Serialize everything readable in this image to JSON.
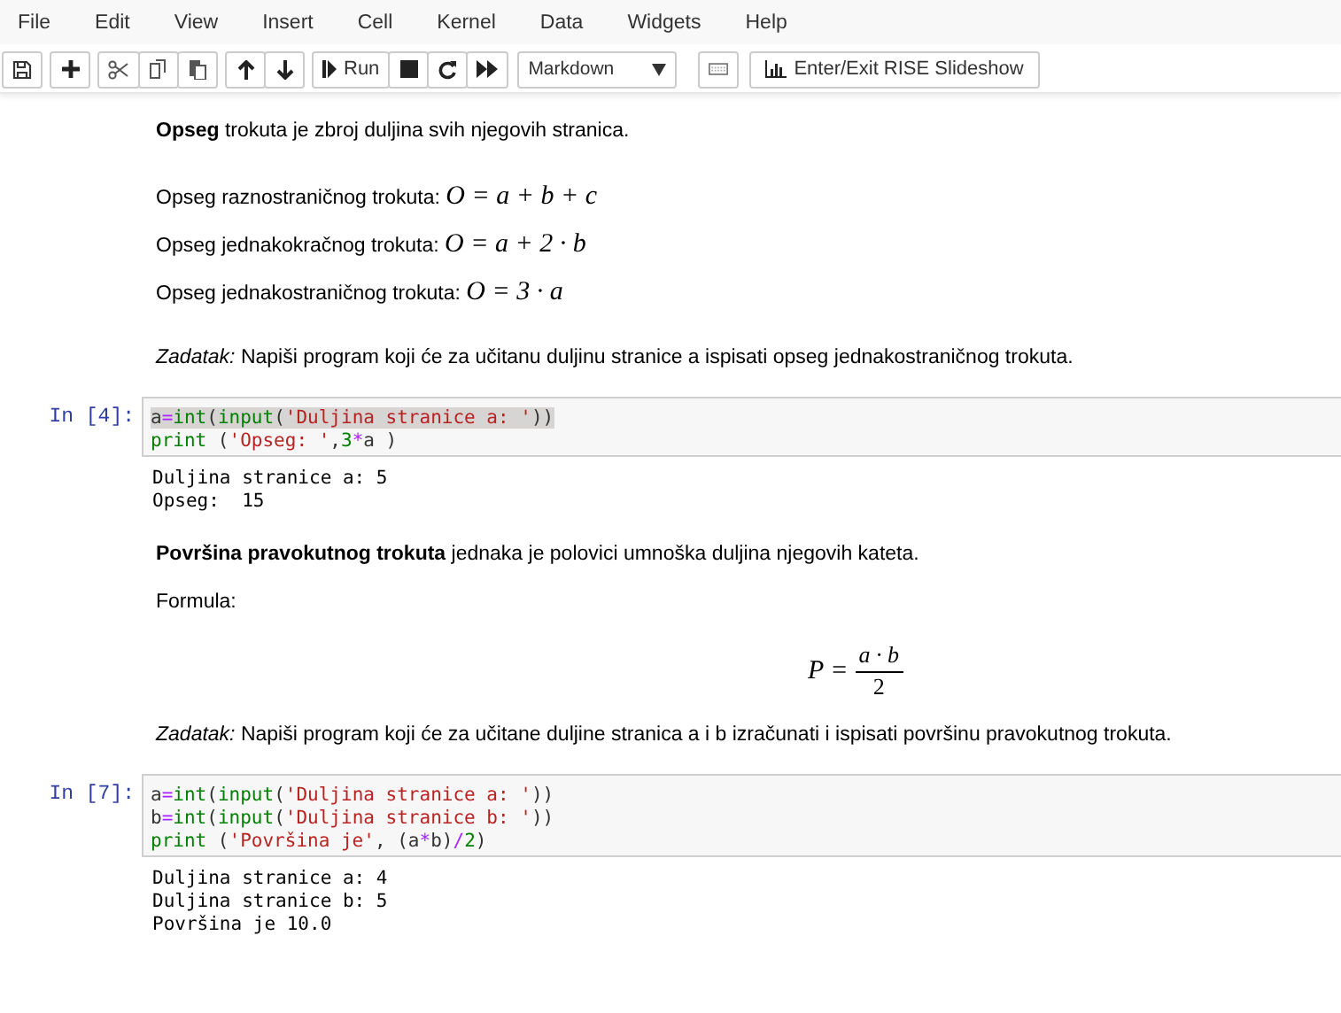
{
  "menu": [
    "File",
    "Edit",
    "View",
    "Insert",
    "Cell",
    "Kernel",
    "Data",
    "Widgets",
    "Help"
  ],
  "toolbar": {
    "groups": [
      [
        {
          "kind": "save"
        }
      ],
      [
        {
          "kind": "plus"
        }
      ],
      [
        {
          "kind": "cut"
        },
        {
          "kind": "copy"
        },
        {
          "kind": "paste"
        }
      ],
      [
        {
          "kind": "up"
        },
        {
          "kind": "down"
        }
      ],
      [
        {
          "kind": "run",
          "label": "Run"
        },
        {
          "kind": "stop"
        },
        {
          "kind": "restart"
        },
        {
          "kind": "fastforward"
        }
      ]
    ],
    "cell_type": "Markdown",
    "rise_label": "Enter/Exit RISE Slideshow"
  },
  "cells": [
    {
      "kind": "markdown",
      "blocks": [
        {
          "kind": "para",
          "text": "**Opseg** trokuta je zbroj duljina svih njegovih stranica."
        },
        {
          "kind": "formula_line",
          "label": "Opseg raznostraničnog trokuta:",
          "math": "O = a + b + c"
        },
        {
          "kind": "formula_line",
          "label": "Opseg jednakokračnog trokuta:",
          "math": "O = a + 2 · b"
        },
        {
          "kind": "formula_line",
          "label": "Opseg jednakostraničnog trokuta:",
          "math": "O = 3 · a"
        },
        {
          "kind": "para",
          "text": "*Zadatak:* Napiši program koji će za učitanu duljinu stranice a ispisati opseg jednakostraničnog trokuta."
        }
      ]
    },
    {
      "kind": "code",
      "prompt": "In [4]:",
      "lines": [
        {
          "highlighted": true,
          "tokens": [
            {
              "text": "a",
              "kind": "plain"
            },
            {
              "text": "=",
              "kind": "op"
            },
            {
              "text": "int",
              "kind": "builtin"
            },
            {
              "text": "(",
              "kind": "plain"
            },
            {
              "text": "input",
              "kind": "builtin"
            },
            {
              "text": "(",
              "kind": "plain"
            },
            {
              "text": "'Duljina stranice a: '",
              "kind": "string"
            },
            {
              "text": "))",
              "kind": "plain"
            }
          ]
        },
        {
          "highlighted": false,
          "tokens": [
            {
              "text": "print",
              "kind": "builtin"
            },
            {
              "text": " (",
              "kind": "plain"
            },
            {
              "text": "'Opseg: '",
              "kind": "string"
            },
            {
              "text": ",",
              "kind": "plain"
            },
            {
              "text": "3",
              "kind": "number"
            },
            {
              "text": "*",
              "kind": "op"
            },
            {
              "text": "a )",
              "kind": "plain"
            }
          ]
        }
      ],
      "output": [
        "Duljina stranice a: 5",
        "Opseg:  15"
      ]
    },
    {
      "kind": "markdown",
      "blocks": [
        {
          "kind": "para",
          "text": "**Površina pravokutnog trokuta** jednaka je polovici umnoška duljina njegovih kateta."
        },
        {
          "kind": "para",
          "text": "Formula:"
        },
        {
          "kind": "fraction",
          "lhs": "P =",
          "numerator": "a · b",
          "denominator": "2"
        },
        {
          "kind": "para",
          "text": "*Zadatak:* Napiši program koji će za učitane duljine stranica a i b izračunati i ispisati površinu pravokutnog trokuta."
        }
      ]
    },
    {
      "kind": "code",
      "prompt": "In [7]:",
      "lines": [
        {
          "highlighted": false,
          "tokens": [
            {
              "text": "a",
              "kind": "plain"
            },
            {
              "text": "=",
              "kind": "op"
            },
            {
              "text": "int",
              "kind": "builtin"
            },
            {
              "text": "(",
              "kind": "plain"
            },
            {
              "text": "input",
              "kind": "builtin"
            },
            {
              "text": "(",
              "kind": "plain"
            },
            {
              "text": "'Duljina stranice a: '",
              "kind": "string"
            },
            {
              "text": "))",
              "kind": "plain"
            }
          ]
        },
        {
          "highlighted": false,
          "tokens": [
            {
              "text": "b",
              "kind": "plain"
            },
            {
              "text": "=",
              "kind": "op"
            },
            {
              "text": "int",
              "kind": "builtin"
            },
            {
              "text": "(",
              "kind": "plain"
            },
            {
              "text": "input",
              "kind": "builtin"
            },
            {
              "text": "(",
              "kind": "plain"
            },
            {
              "text": "'Duljina stranice b: '",
              "kind": "string"
            },
            {
              "text": "))",
              "kind": "plain"
            }
          ]
        },
        {
          "highlighted": false,
          "tokens": [
            {
              "text": "print",
              "kind": "builtin"
            },
            {
              "text": " (",
              "kind": "plain"
            },
            {
              "text": "'Površina je'",
              "kind": "string"
            },
            {
              "text": ", (a",
              "kind": "plain"
            },
            {
              "text": "*",
              "kind": "op"
            },
            {
              "text": "b)",
              "kind": "plain"
            },
            {
              "text": "/",
              "kind": "op"
            },
            {
              "text": "2",
              "kind": "number"
            },
            {
              "text": ")",
              "kind": "plain"
            }
          ]
        }
      ],
      "output": [
        "Duljina stranice a: 4",
        "Duljina stranice b: 5",
        "Površina je 10.0"
      ]
    }
  ]
}
